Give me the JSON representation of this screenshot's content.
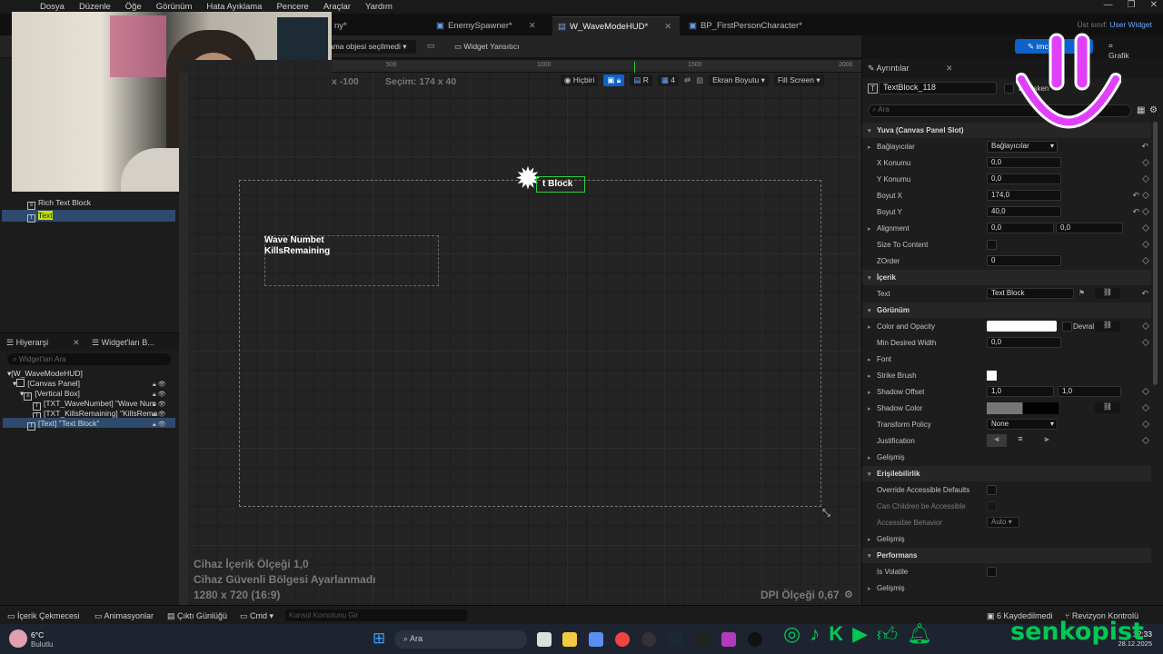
{
  "menu": [
    "Dosya",
    "Düzenle",
    "Öğe",
    "Görünüm",
    "Hata Ayıklama",
    "Pencere",
    "Araçlar",
    "Yardım"
  ],
  "tabs": {
    "t1": "ny*",
    "t2": "EnemySpawner*",
    "t3": "W_WaveModeHUD*",
    "t4": "BP_FirstPersonCharacter*",
    "parent_class": "Üst sınıf:",
    "parent_value": "User Widget"
  },
  "toolbar": {
    "selection": "ama objesi seçilmedi",
    "reflector": "Widget Yansıtıcı",
    "designer": "imc",
    "graph": "Grafik"
  },
  "viewport": {
    "ruler": [
      "500",
      "1000",
      "1500",
      "2000"
    ],
    "coord": "x -100",
    "selection_size": "Seçim: 174 x 40",
    "none_btn": "Hiçbiri",
    "r_btn": "R",
    "grid_num": "4",
    "screen_size": "Ekran Boyutu",
    "fill_screen": "Fill Screen",
    "widget_label": "t Block",
    "wave_line1": "Wave Numbet",
    "wave_line2": "KillsRemaining",
    "scale1": "Cihaz İçerik Ölçeği 1,0",
    "scale2": "Cihaz Güvenli Bölgesi Ayarlanmadı",
    "resolution": "1280 x 720 (16:9)",
    "dpi": "DPI Ölçeği 0,67"
  },
  "palette": {
    "rich": "Rich Text Block",
    "text": "Text"
  },
  "hierarchy": {
    "tab1": "Hiyerarşi",
    "tab2": "Widget'ları B...",
    "search": "Widget'ları Ara",
    "items": [
      "[W_WaveModeHUD]",
      "[Canvas Panel]",
      "[Vertical Box]",
      "[TXT_WaveNumbet] \"Wave Num",
      "[TXT_KillsRemaining] \"KillsRema",
      "[Text] \"Text Block\""
    ]
  },
  "details": {
    "title": "Ayrıntılar",
    "name": "TextBlock_118",
    "var": "Değişken",
    "search": "Ara",
    "slot_section": "Yuva (Canvas Panel Slot)",
    "anchors": "Bağlayıcılar",
    "anchors_val": "Bağlayıcılar",
    "xpos": "X Konumu",
    "xpos_val": "0,0",
    "ypos": "Y Konumu",
    "ypos_val": "0,0",
    "sizex": "Boyut X",
    "sizex_val": "174,0",
    "sizey": "Boyut Y",
    "sizey_val": "40,0",
    "align": "Alignment",
    "align1": "0,0",
    "align2": "0,0",
    "size_to_content": "Size To Content",
    "zorder": "ZOrder",
    "zorder_val": "0",
    "content_section": "İçerik",
    "text": "Text",
    "text_val": "Text Block",
    "appearance_section": "Görünüm",
    "color": "Color and Opacity",
    "devral": "Devral",
    "min_width": "Min Desired Width",
    "min_width_val": "0,0",
    "font": "Font",
    "strike": "Strike Brush",
    "shadow_offset": "Shadow Offset",
    "so1": "1,0",
    "so2": "1,0",
    "shadow_color": "Shadow Color",
    "transform_policy": "Transform Policy",
    "tp_val": "None",
    "justification": "Justification",
    "advanced": "Gelişmiş",
    "access_section": "Erişilebilirlik",
    "override": "Override Accessible Defaults",
    "children_access": "Can Children be Accessible",
    "access_behavior": "Accessible Behavior",
    "ab_val": "Auto",
    "advanced2": "Gelişmiş",
    "perf_section": "Performans",
    "volatile": "Is Volatile",
    "advanced3": "Gelişmiş"
  },
  "bottom": {
    "content": "İçerik Çekmecesi",
    "anim": "Animasyonlar",
    "output": "Çıktı Günlüğü",
    "cmd": "Cmd",
    "console": "Konsol Komutunu Gir",
    "saved": "6 Kaydedilmedi",
    "revision": "Revizyon Kontrolü"
  },
  "taskbar": {
    "temp": "6°C",
    "weather": "Bulutlu",
    "search": "Ara",
    "time": "12:33",
    "date": "28.12.2025"
  },
  "stream": {
    "name": "senkopist"
  },
  "colors": {
    "accent": "#0e62c9",
    "green": "#4caf50",
    "brand": "#00c853"
  }
}
